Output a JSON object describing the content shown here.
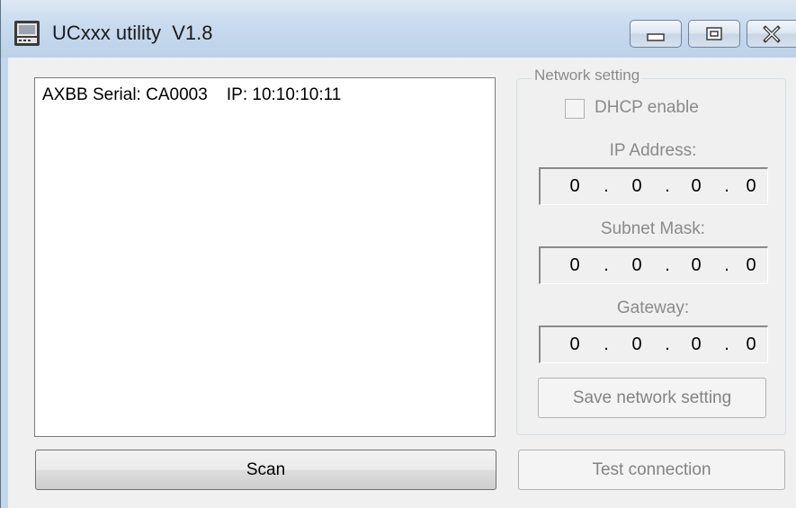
{
  "window": {
    "title": "UCxxx utility  V1.8",
    "app_icon": "computer-drive-icon"
  },
  "caption_buttons": {
    "minimize_icon": "minimize-icon",
    "maximize_icon": "maximize-icon",
    "close_icon": "close-icon"
  },
  "device_list": {
    "items": [
      {
        "text": "AXBB Serial: CA0003    IP: 10:10:10:11"
      }
    ]
  },
  "scan_button": {
    "label": "Scan"
  },
  "test_button": {
    "label": "Test connection"
  },
  "network": {
    "group_title": "Network setting",
    "dhcp": {
      "label": "DHCP enable",
      "checked": false
    },
    "ip": {
      "label": "IP Address:",
      "octets": [
        "0",
        "0",
        "0",
        "0"
      ]
    },
    "subnet": {
      "label": "Subnet Mask:",
      "octets": [
        "0",
        "0",
        "0",
        "0"
      ]
    },
    "gateway": {
      "label": "Gateway:",
      "octets": [
        "0",
        "0",
        "0",
        "0"
      ]
    },
    "separator": ".",
    "save_label": "Save network setting"
  },
  "colors": {
    "titlebar": "#c4d6eb",
    "client_bg": "#f0f0f0",
    "disabled_text": "#8a8a8a"
  }
}
